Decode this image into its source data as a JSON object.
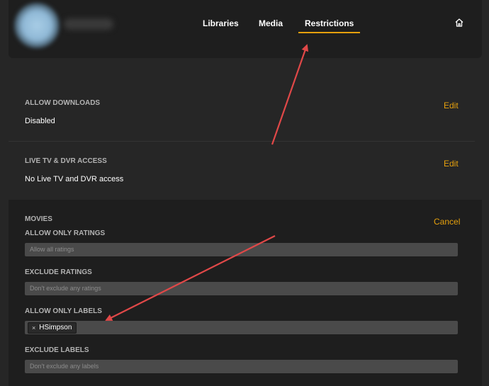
{
  "tabs": [
    {
      "label": "Libraries"
    },
    {
      "label": "Media"
    },
    {
      "label": "Restrictions",
      "active": true
    }
  ],
  "sections": {
    "downloads": {
      "title": "ALLOW DOWNLOADS",
      "value": "Disabled",
      "action": "Edit"
    },
    "livetv": {
      "title": "LIVE TV & DVR ACCESS",
      "value": "No Live TV and DVR access",
      "action": "Edit"
    },
    "movies": {
      "title": "MOVIES",
      "action": "Cancel",
      "allow_ratings": {
        "label": "ALLOW ONLY RATINGS",
        "placeholder": "Allow all ratings"
      },
      "exclude_ratings": {
        "label": "EXCLUDE RATINGS",
        "placeholder": "Don't exclude any ratings"
      },
      "allow_labels": {
        "label": "ALLOW ONLY LABELS",
        "chips": [
          "HSimpson"
        ],
        "chip_remove": "×"
      },
      "exclude_labels": {
        "label": "EXCLUDE LABELS",
        "placeholder": "Don't exclude any labels"
      }
    }
  },
  "colors": {
    "accent": "#e5a00d",
    "annotation": "#e04848",
    "background": "#262626",
    "panel": "#1e1e1e"
  },
  "icons": {
    "home": "home-icon"
  }
}
